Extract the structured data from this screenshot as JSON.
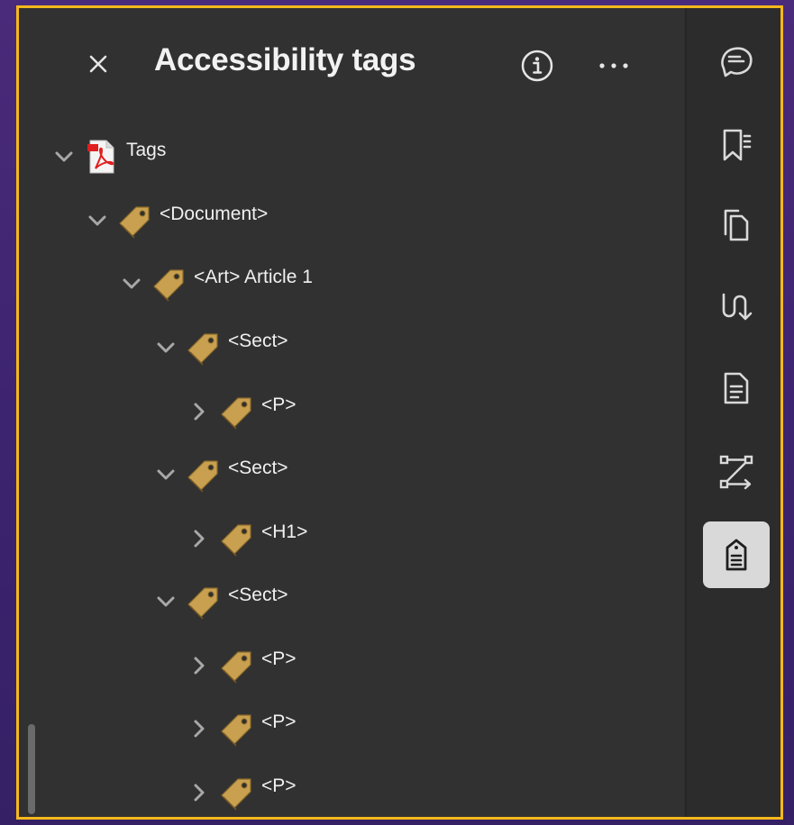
{
  "header": {
    "title": "Accessibility tags",
    "close_icon": "close-icon",
    "info_icon": "info-icon",
    "more_icon": "more-icon"
  },
  "tree": {
    "root": {
      "label": "Tags",
      "expanded": true,
      "icon": "pdf-icon"
    },
    "nodes": [
      {
        "label": "<Document>",
        "level": 1,
        "expanded": true,
        "icon": "tag-icon"
      },
      {
        "label": "<Art> Article 1",
        "level": 2,
        "expanded": true,
        "icon": "tag-icon"
      },
      {
        "label": "<Sect>",
        "level": 3,
        "expanded": true,
        "icon": "tag-icon"
      },
      {
        "label": "<P>",
        "level": 4,
        "expanded": false,
        "icon": "tag-icon"
      },
      {
        "label": "<Sect>",
        "level": 3,
        "expanded": true,
        "icon": "tag-icon"
      },
      {
        "label": "<H1>",
        "level": 4,
        "expanded": false,
        "icon": "tag-icon"
      },
      {
        "label": "<Sect>",
        "level": 3,
        "expanded": true,
        "icon": "tag-icon"
      },
      {
        "label": "<P>",
        "level": 4,
        "expanded": false,
        "icon": "tag-icon"
      },
      {
        "label": "<P>",
        "level": 4,
        "expanded": false,
        "icon": "tag-icon"
      },
      {
        "label": "<P>",
        "level": 4,
        "expanded": false,
        "icon": "tag-icon"
      }
    ]
  },
  "rail": {
    "items": [
      {
        "icon": "comment-icon",
        "active": false
      },
      {
        "icon": "bookmark-icon",
        "active": false
      },
      {
        "icon": "pages-icon",
        "active": false
      },
      {
        "icon": "reading-order-icon",
        "active": false
      },
      {
        "icon": "content-icon",
        "active": false
      },
      {
        "icon": "order-icon",
        "active": false
      },
      {
        "icon": "accessibility-tags-icon",
        "active": true
      }
    ]
  },
  "colors": {
    "accent_border": "#f5b81c",
    "panel_bg": "#313131",
    "tag_gold": "#c9a050",
    "active_rail_bg": "#d9d9d9"
  }
}
